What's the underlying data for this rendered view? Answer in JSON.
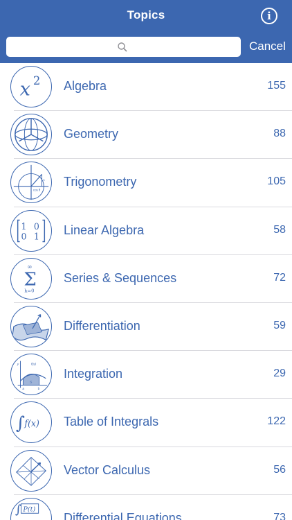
{
  "nav": {
    "title": "Topics",
    "info_icon": "info-icon",
    "info_glyph": "i"
  },
  "search": {
    "placeholder": "",
    "value": "",
    "cancel_label": "Cancel"
  },
  "colors": {
    "nav_bg": "#3c67b0",
    "accent": "#3c67b0",
    "divider": "#d9d9de"
  },
  "topics": [
    {
      "label": "Algebra",
      "count": "155",
      "icon": "algebra-x-squared-icon"
    },
    {
      "label": "Geometry",
      "count": "88",
      "icon": "geometry-sphere-icon"
    },
    {
      "label": "Trigonometry",
      "count": "105",
      "icon": "trigonometry-unit-circle-icon"
    },
    {
      "label": "Linear Algebra",
      "count": "58",
      "icon": "linear-algebra-matrix-icon"
    },
    {
      "label": "Series & Sequences",
      "count": "72",
      "icon": "series-sigma-icon"
    },
    {
      "label": "Differentiation",
      "count": "59",
      "icon": "differentiation-tangent-icon"
    },
    {
      "label": "Integration",
      "count": "29",
      "icon": "integration-area-icon"
    },
    {
      "label": "Table of Integrals",
      "count": "122",
      "icon": "integral-fx-icon"
    },
    {
      "label": "Vector Calculus",
      "count": "56",
      "icon": "vector-calculus-icon"
    },
    {
      "label": "Differential Equations",
      "count": "73",
      "icon": "differential-equations-icon"
    }
  ]
}
